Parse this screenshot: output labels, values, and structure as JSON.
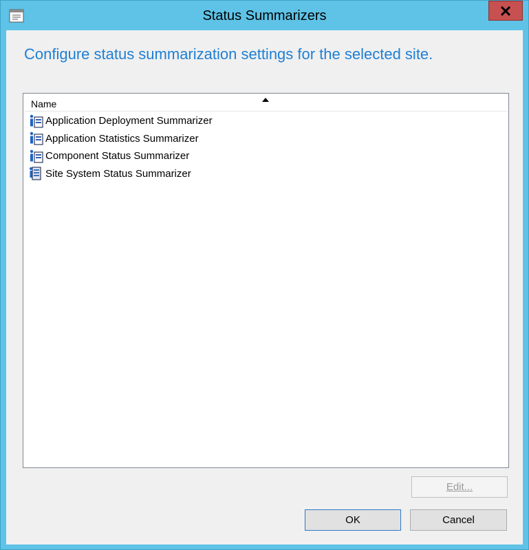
{
  "window": {
    "title": "Status Summarizers"
  },
  "heading": "Configure status summarization settings for the selected site.",
  "list": {
    "column_header": "Name",
    "items": [
      {
        "label": "Application Deployment Summarizer",
        "icon": "info-document-icon"
      },
      {
        "label": "Application Statistics Summarizer",
        "icon": "info-document-icon"
      },
      {
        "label": "Component Status Summarizer",
        "icon": "info-document-icon"
      },
      {
        "label": "Site System Status Summarizer",
        "icon": "server-document-icon"
      }
    ]
  },
  "buttons": {
    "edit_label": "Edit...",
    "ok_label": "OK",
    "cancel_label": "Cancel"
  },
  "colors": {
    "frame": "#5ec3e6",
    "heading": "#1f7fd4",
    "close": "#c75050"
  }
}
